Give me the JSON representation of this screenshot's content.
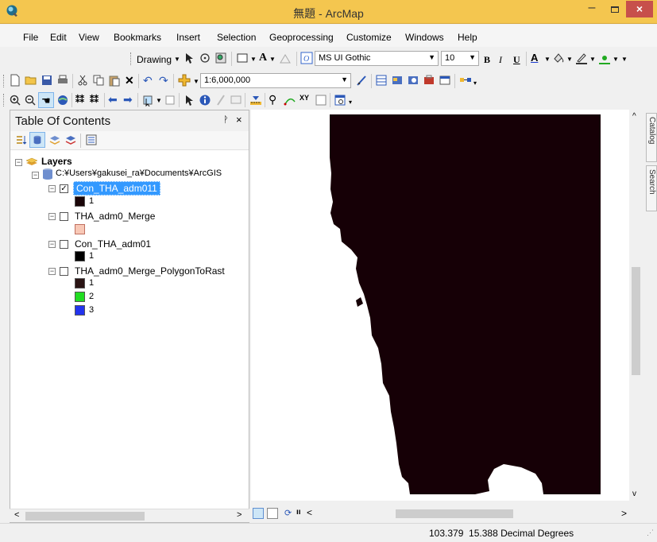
{
  "window": {
    "title": "無題 - ArcMap",
    "minimize": "–",
    "close": "×"
  },
  "menu": [
    "File",
    "Edit",
    "View",
    "Bookmarks",
    "Insert",
    "Selection",
    "Geoprocessing",
    "Customize",
    "Windows",
    "Help"
  ],
  "drawing_toolbar": {
    "drawing_label": "Drawing",
    "font_name": "MS UI Gothic",
    "font_size": "10",
    "bold": "B",
    "italic": "I",
    "underline": "U",
    "font_color": "A"
  },
  "standard_toolbar": {
    "scale": "1:6,000,000"
  },
  "toc": {
    "title": "Table Of Contents",
    "pin": "ᚹ",
    "close": "×",
    "root_label": "Layers",
    "source_path": "C:¥Users¥gakusei_ra¥Documents¥ArcGIS",
    "layers": [
      {
        "name": "Con_THA_adm011",
        "checked": true,
        "selected": true,
        "legend": [
          {
            "label": "1",
            "color": "#1a0508"
          }
        ]
      },
      {
        "name": "THA_adm0_Merge",
        "checked": false,
        "selected": false,
        "legend": [
          {
            "label": "",
            "color": "#f8c8b6"
          }
        ]
      },
      {
        "name": "Con_THA_adm01",
        "checked": false,
        "selected": false,
        "legend": [
          {
            "label": "1",
            "color": "#000000"
          }
        ]
      },
      {
        "name": "THA_adm0_Merge_PolygonToRast",
        "checked": false,
        "selected": false,
        "legend": [
          {
            "label": "1",
            "color": "#2a1414"
          },
          {
            "label": "2",
            "color": "#22dd22"
          },
          {
            "label": "3",
            "color": "#2233ee"
          }
        ]
      }
    ]
  },
  "map": {
    "raster_color": "#160006",
    "background": "#ffffff"
  },
  "side_tabs": [
    "Catalog",
    "Search"
  ],
  "status": {
    "coordinates": "103.379  15.388 Decimal Degrees"
  },
  "colors": {
    "title_bar": "#f4c64f",
    "close_button": "#c7504b",
    "selection": "#3399ff"
  }
}
